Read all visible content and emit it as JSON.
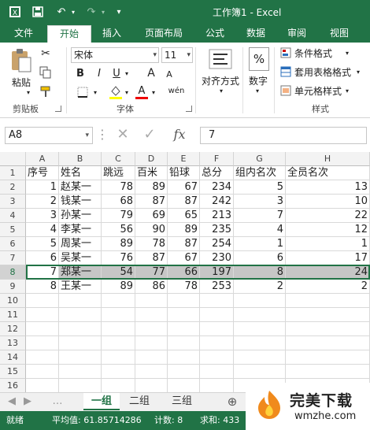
{
  "qat": {
    "save_icon": "save-icon",
    "undo_icon": "undo-icon",
    "redo_icon": "redo-icon"
  },
  "window": {
    "title": "工作簿1 - Excel"
  },
  "tabs": [
    {
      "label": "文件"
    },
    {
      "label": "开始"
    },
    {
      "label": "插入"
    },
    {
      "label": "页面布局"
    },
    {
      "label": "公式"
    },
    {
      "label": "数据"
    },
    {
      "label": "审阅"
    },
    {
      "label": "视图"
    }
  ],
  "ribbon": {
    "paste_label": "粘贴",
    "clipboard_label": "剪贴板",
    "font_name": "宋体",
    "font_size": "11",
    "bold": "B",
    "italic": "I",
    "underline": "U",
    "font_size_up": "A",
    "font_size_down": "A",
    "font_color_glyph": "A",
    "wen": "wén",
    "font_group_label": "字体",
    "align_label": "对齐方式",
    "number_label": "数字",
    "percent": "%",
    "conditional_format": "条件格式",
    "table_format": "套用表格格式",
    "cell_styles": "单元格样式",
    "styles_group_label": "样式"
  },
  "formula_bar": {
    "name_box": "A8",
    "fx": "fx",
    "value": "7"
  },
  "columns": [
    "A",
    "B",
    "C",
    "D",
    "E",
    "F",
    "G",
    "H"
  ],
  "rows": [
    "1",
    "2",
    "3",
    "4",
    "5",
    "6",
    "7",
    "8",
    "9",
    "10",
    "11",
    "12",
    "13",
    "14",
    "15",
    "16"
  ],
  "table": {
    "headers": [
      "序号",
      "姓名",
      "跳远",
      "百米",
      "铅球",
      "总分",
      "组内名次",
      "全员名次"
    ],
    "rows": [
      [
        "1",
        "赵某一",
        "78",
        "89",
        "67",
        "234",
        "5",
        "13"
      ],
      [
        "2",
        "钱某一",
        "68",
        "87",
        "87",
        "242",
        "3",
        "10"
      ],
      [
        "3",
        "孙某一",
        "79",
        "69",
        "65",
        "213",
        "7",
        "22"
      ],
      [
        "4",
        "李某一",
        "56",
        "90",
        "89",
        "235",
        "4",
        "12"
      ],
      [
        "5",
        "周某一",
        "89",
        "78",
        "87",
        "254",
        "1",
        "1"
      ],
      [
        "6",
        "吴某一",
        "76",
        "87",
        "67",
        "230",
        "6",
        "17"
      ],
      [
        "7",
        "郑某一",
        "54",
        "77",
        "66",
        "197",
        "8",
        "24"
      ],
      [
        "8",
        "王某一",
        "89",
        "86",
        "78",
        "253",
        "2",
        "2"
      ]
    ]
  },
  "sheets": [
    {
      "label": "一组"
    },
    {
      "label": "二组"
    },
    {
      "label": "三组"
    }
  ],
  "add_sheet": "⊕",
  "status": {
    "ready": "就绪",
    "average": "平均值: 61.85714286",
    "count": "计数: 8",
    "sum": "求和: 433"
  },
  "watermark": {
    "brand": "完美下载",
    "url": "wmzhe.com"
  },
  "colors": {
    "accent": "#217346"
  }
}
